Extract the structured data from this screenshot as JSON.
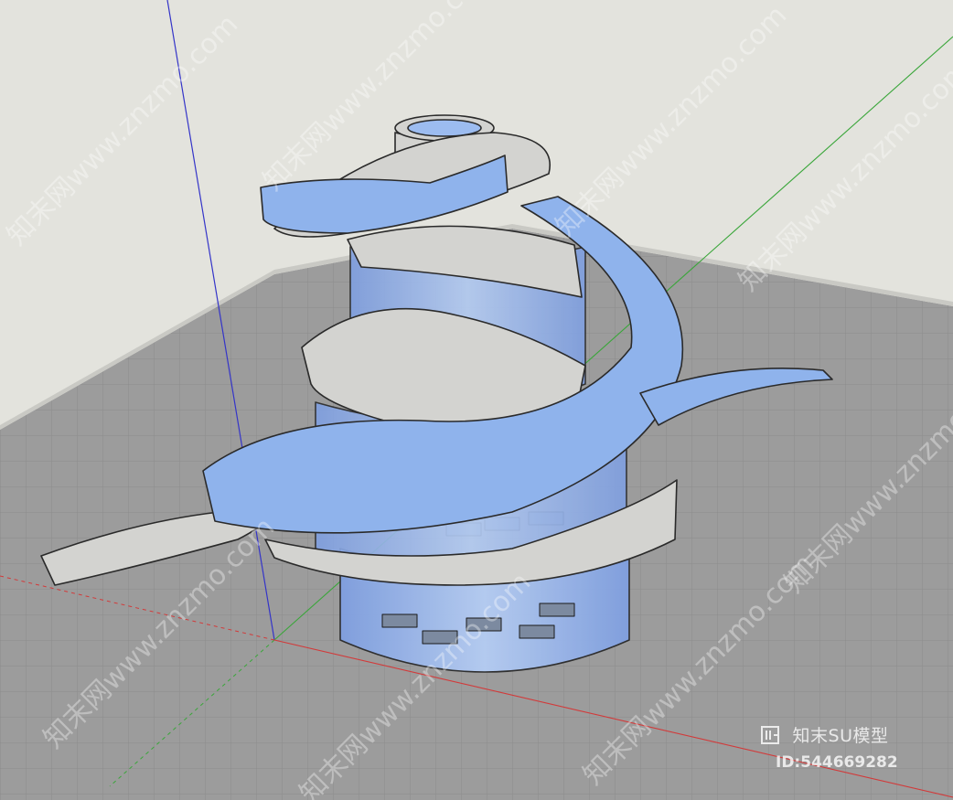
{
  "viewport": {
    "sky_color": "#e3e3dd",
    "ground_color": "#9e9e9e",
    "axis_colors": {
      "red": "#d23a3a",
      "green": "#3aa63a",
      "blue": "#3434c8"
    }
  },
  "model": {
    "glass_color": "#8fb3ec",
    "concrete_color": "#d3d3d0",
    "edge_color": "#2a2a2a"
  },
  "watermark": {
    "brand": "知末SU模型",
    "id_text": "ID:544669282",
    "tiled_text": "知末网www.znzmo.com"
  }
}
